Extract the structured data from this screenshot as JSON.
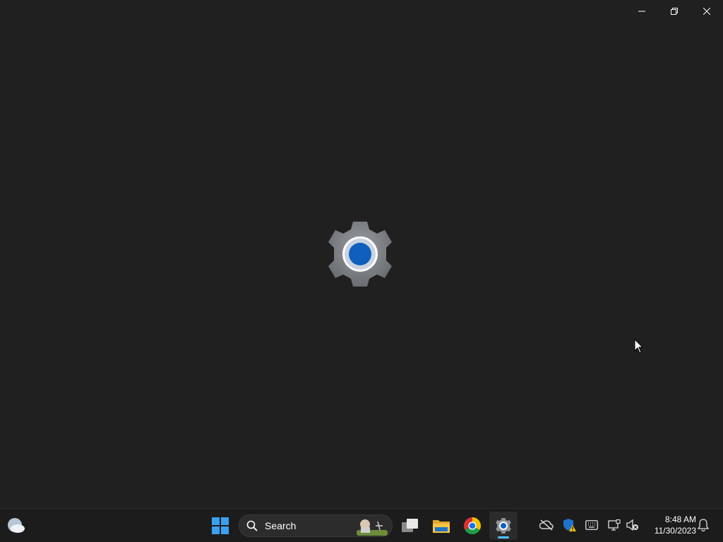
{
  "window": {
    "controls": [
      {
        "name": "minimize-button",
        "icon": "minimize-icon"
      },
      {
        "name": "maximize-button",
        "icon": "restore-icon"
      },
      {
        "name": "close-button",
        "icon": "close-icon"
      }
    ],
    "splash_icon": "settings-gear-icon",
    "colors": {
      "background": "#202020",
      "gear": "#7a7d82",
      "gear_center": "#0f5fbf"
    }
  },
  "taskbar": {
    "weather_icon": "weather-cloud-icon",
    "start_icon": "windows-start-icon",
    "search": {
      "label": "Search",
      "icon": "search-icon"
    },
    "pinned": [
      {
        "name": "task-view",
        "icon": "task-view-icon"
      },
      {
        "name": "file-explorer",
        "icon": "folder-icon"
      },
      {
        "name": "chrome",
        "icon": "chrome-icon"
      },
      {
        "name": "settings",
        "icon": "settings-gear-icon",
        "active": true
      }
    ],
    "tray": [
      {
        "name": "onedrive",
        "icon": "cloud-offline-icon"
      },
      {
        "name": "security",
        "icon": "shield-warning-icon"
      },
      {
        "name": "keyboard",
        "icon": "keyboard-icon"
      },
      {
        "name": "network",
        "icon": "network-monitor-icon"
      },
      {
        "name": "volume",
        "icon": "volume-muted-icon"
      }
    ],
    "clock": {
      "time": "8:48 AM",
      "date": "11/30/2023"
    },
    "notification_icon": "bell-icon",
    "accent": "#4cc2ff"
  }
}
